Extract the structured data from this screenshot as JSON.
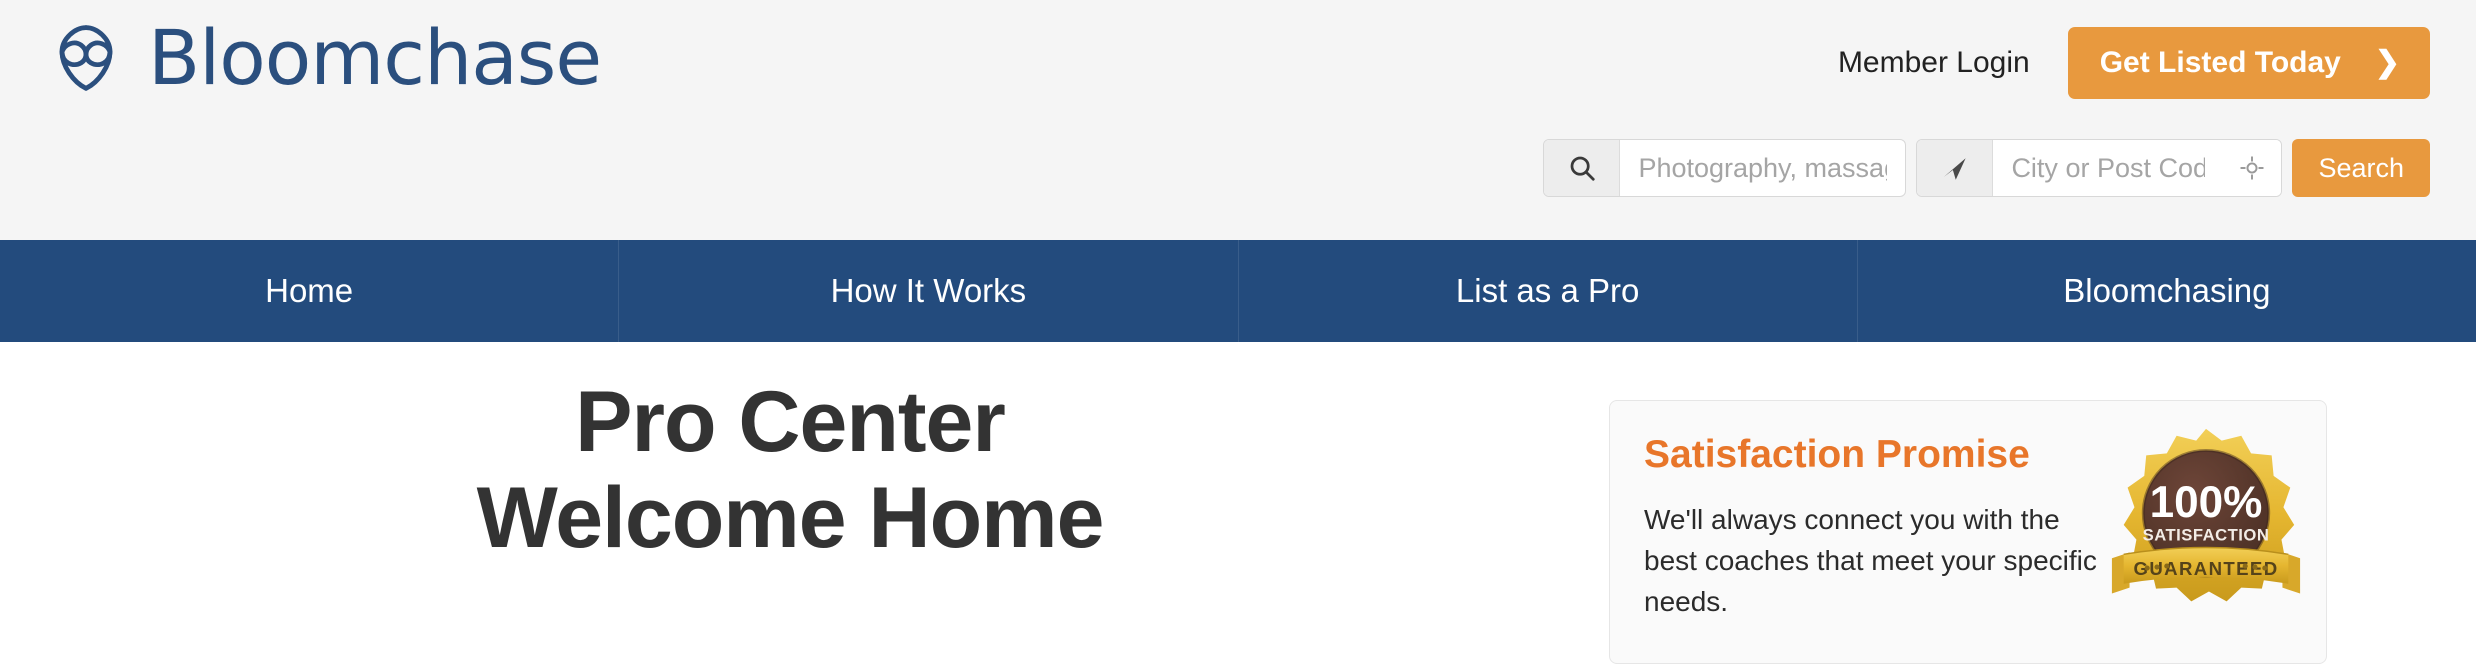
{
  "brand": {
    "name": "Bloomchase",
    "logo_icon": "bloomchase-petals-icon",
    "logo_color": "#2b4f7e"
  },
  "header": {
    "member_login_label": "Member Login",
    "cta_label": "Get Listed Today",
    "cta_chevron": "❯",
    "cta_color": "#e8993e",
    "background": "#f5f5f5"
  },
  "search": {
    "keyword_icon": "search-icon",
    "keyword_placeholder": "Photography, massage",
    "keyword_value": "",
    "location_icon": "navigation-arrow-icon",
    "location_placeholder": "City or Post Code",
    "location_value": "",
    "geolocate_icon": "crosshair-icon",
    "submit_label": "Search"
  },
  "nav": {
    "background": "#234b7d",
    "items": [
      {
        "label": "Home",
        "name": "nav-item-home"
      },
      {
        "label": "How It Works",
        "name": "nav-item-how-it-works"
      },
      {
        "label": "List as a Pro",
        "name": "nav-item-list-as-a-pro"
      },
      {
        "label": "Bloomchasing",
        "name": "nav-item-bloomchasing"
      }
    ]
  },
  "main": {
    "heading_line1": "Pro Center",
    "heading_line2": "Welcome Home"
  },
  "promise_card": {
    "title": "Satisfaction Promise",
    "title_color": "#e8762a",
    "body": "We'll always connect you with the best coaches that meet your specific needs.",
    "badge": {
      "icon": "satisfaction-guarantee-badge-icon",
      "percent": "100%",
      "subtitle": "SATISFACTION",
      "ribbon": "GUARANTEED",
      "gold": "#e8b830",
      "brown": "#5c3b2e"
    }
  }
}
